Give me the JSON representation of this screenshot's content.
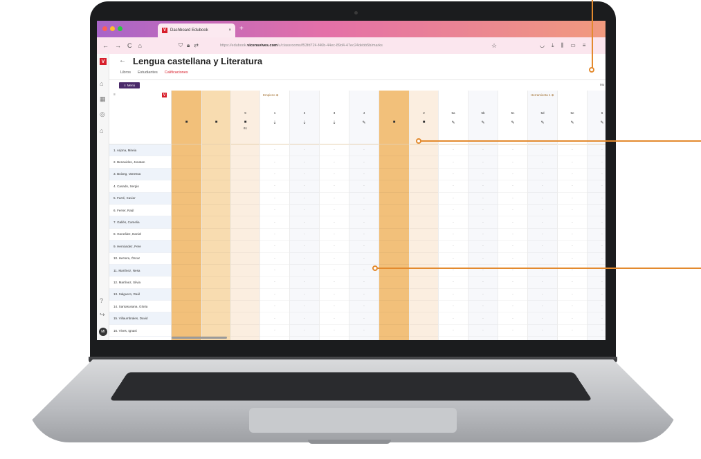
{
  "browser": {
    "tab_title": "Dashboard Edubook",
    "tab_close": "×",
    "new_tab": "+",
    "url_prefix": "https://edubook.",
    "url_domain": "vicensvives.com",
    "url_path": "/u/classrooms/f53fd724-f46b-44ec-89d4-47ec24debb5b/marks",
    "nav": {
      "back": "←",
      "forward": "→",
      "reload": "C",
      "home": "⌂"
    },
    "traffic_colors": [
      "#ff5f57",
      "#febc2e",
      "#28c840"
    ]
  },
  "app": {
    "brand_letter": "V",
    "back_arrow": "←",
    "title": "Lengua castellana y Literatura",
    "tabs": [
      {
        "label": "Libros",
        "active": false
      },
      {
        "label": "Estudiantes",
        "active": false
      },
      {
        "label": "Calificaciones",
        "active": true
      }
    ],
    "menu_label": "Menú",
    "topright_label": "Mo",
    "accent_color": "#d71e2b",
    "menu_color": "#4a2a6a"
  },
  "grid": {
    "filter_icon": "≡",
    "groups": [
      "Empiezo ⊕",
      "Herramienta 1 ⊕"
    ],
    "columns_group1": [
      "1",
      "2",
      "3",
      "4"
    ],
    "columns_group2": [
      "5a",
      "5b",
      "5c",
      "5d",
      "5e",
      "6"
    ],
    "summary_number": "9",
    "summary_sub": "61",
    "second_summary": "2",
    "cell_placeholder": "-",
    "students": [
      "1. Arjona, Mireia",
      "2. Benavides, Jonatan",
      "3. Boixeg, Vanessa",
      "4. Casado, Sergio",
      "5. Farré, Xavier",
      "6. Ferrer, Raúl",
      "7. Gallés, Camelia",
      "8. González, Daniel",
      "9. Hernández, Pere",
      "10. Herrera, Óscar",
      "11. Martínez, Nesa",
      "12. Martínez, Silvia",
      "13. Salguero, Raúl",
      "14. Santasusana, Gloria",
      "15. Villaumbrales, David",
      "16. Vives, Ignasi"
    ]
  },
  "rail": {
    "avatar_initials": "MI"
  }
}
